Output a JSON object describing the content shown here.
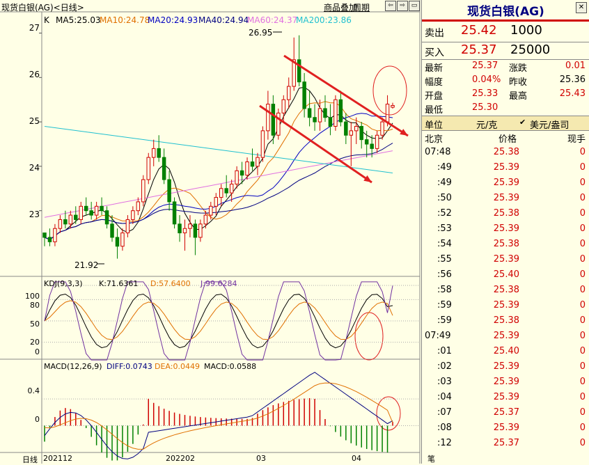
{
  "header": {
    "title": "现货白银(AG)<日线>",
    "menu_overlay": "商品叠加",
    "menu_period": "周期",
    "nav_buttons": [
      "⇦",
      "⇨",
      "▭"
    ]
  },
  "main_chart": {
    "k_label": "K",
    "legend": [
      {
        "text": "MA5:25.03",
        "color": "#000000"
      },
      {
        "text": "MA10:24.78",
        "color": "#e07000"
      },
      {
        "text": "MA20:24.93",
        "color": "#0000c0"
      },
      {
        "text": "MA40:24.94",
        "color": "#000080"
      },
      {
        "text": "MA60:24.37",
        "color": "#e070e0"
      },
      {
        "text": "MA200:23.86",
        "color": "#20c0d0"
      }
    ],
    "y_ticks": [
      "27",
      "26",
      "25",
      "24",
      "23"
    ],
    "high_marker": "26.95",
    "low_marker": "21.92"
  },
  "kdj": {
    "label": "KDJ(9,3,3)",
    "k": "K:71.6361",
    "d": "D:57.6400",
    "j": "J:99.6284",
    "y_ticks": [
      "100",
      "80",
      "50",
      "20",
      "0"
    ]
  },
  "macd": {
    "label": "MACD(12,26,9)",
    "diff": "DIFF:0.0743",
    "dea": "DEA:0.0449",
    "macd": "MACD:0.0588",
    "y_ticks": [
      "0.4",
      "0"
    ]
  },
  "x_axis": {
    "period_label": "日线",
    "ticks": [
      "202112",
      "202202",
      "03",
      "04"
    ]
  },
  "quote_panel": {
    "title": "现货白银(AG)",
    "sell_label": "卖出",
    "sell_price": "25.42",
    "sell_vol": "1000",
    "buy_label": "买入",
    "buy_price": "25.37",
    "buy_vol": "25000",
    "stats": {
      "latest_label": "最新",
      "latest": "25.37",
      "change_label": "涨跌",
      "change": "0.01",
      "pct_label": "幅度",
      "pct": "0.04%",
      "prev_label": "昨收",
      "prev": "25.36",
      "open_label": "开盘",
      "open": "25.33",
      "high_label": "最高",
      "high": "25.43",
      "low_label": "最低",
      "low": "25.30"
    },
    "unit_label": "单位",
    "unit_value": "元/克",
    "unit_option": "美元/盎司",
    "trade_headers": {
      "time": "北京",
      "price": "价格",
      "qty": "现手"
    },
    "trades": [
      {
        "time": "07:48",
        "price": "25.38",
        "qty": "0"
      },
      {
        "time": ":49",
        "price": "25.39",
        "qty": "0"
      },
      {
        "time": ":49",
        "price": "25.39",
        "qty": "0"
      },
      {
        "time": ":50",
        "price": "25.39",
        "qty": "0"
      },
      {
        "time": ":52",
        "price": "25.38",
        "qty": "0"
      },
      {
        "time": ":53",
        "price": "25.39",
        "qty": "0"
      },
      {
        "time": ":54",
        "price": "25.38",
        "qty": "0"
      },
      {
        "time": ":55",
        "price": "25.39",
        "qty": "0"
      },
      {
        "time": ":56",
        "price": "25.40",
        "qty": "0"
      },
      {
        "time": ":58",
        "price": "25.38",
        "qty": "0"
      },
      {
        "time": ":59",
        "price": "25.39",
        "qty": "0"
      },
      {
        "time": ":59",
        "price": "25.38",
        "qty": "0"
      },
      {
        "time": "07:49",
        "price": "25.39",
        "qty": "0"
      },
      {
        "time": ":01",
        "price": "25.40",
        "qty": "0"
      },
      {
        "time": ":02",
        "price": "25.39",
        "qty": "0"
      },
      {
        "time": ":03",
        "price": "25.39",
        "qty": "0"
      },
      {
        "time": ":04",
        "price": "25.39",
        "qty": "0"
      },
      {
        "time": ":07",
        "price": "25.37",
        "qty": "0"
      },
      {
        "time": ":08",
        "price": "25.39",
        "qty": "0"
      },
      {
        "time": ":12",
        "price": "25.37",
        "qty": "0"
      }
    ],
    "bottom_tab": "笔"
  },
  "chart_data": {
    "type": "candlestick",
    "price_range": [
      21.6,
      27.4
    ],
    "candles_ohlc": [
      [
        22.5,
        22.5,
        22.2,
        22.4
      ],
      [
        22.4,
        22.6,
        22.2,
        22.3
      ],
      [
        22.3,
        22.7,
        22.2,
        22.6
      ],
      [
        22.6,
        22.9,
        22.5,
        22.8
      ],
      [
        22.8,
        23.0,
        22.6,
        22.7
      ],
      [
        22.7,
        23.0,
        22.6,
        22.9
      ],
      [
        22.9,
        23.1,
        22.7,
        22.8
      ],
      [
        22.8,
        23.2,
        22.7,
        23.1
      ],
      [
        23.1,
        23.3,
        22.9,
        23.0
      ],
      [
        23.0,
        23.2,
        22.8,
        22.9
      ],
      [
        22.9,
        23.2,
        22.8,
        23.1
      ],
      [
        23.1,
        23.3,
        22.9,
        23.0
      ],
      [
        23.0,
        23.1,
        22.6,
        22.7
      ],
      [
        22.7,
        22.9,
        22.3,
        22.4
      ],
      [
        22.4,
        22.6,
        21.92,
        22.2
      ],
      [
        22.2,
        22.6,
        22.1,
        22.5
      ],
      [
        22.5,
        22.9,
        22.4,
        22.8
      ],
      [
        22.8,
        23.1,
        22.7,
        23.0
      ],
      [
        23.0,
        23.3,
        22.9,
        23.2
      ],
      [
        23.2,
        23.8,
        23.1,
        23.7
      ],
      [
        23.7,
        24.3,
        23.6,
        24.2
      ],
      [
        24.2,
        24.6,
        24.0,
        24.4
      ],
      [
        24.4,
        24.7,
        24.1,
        24.2
      ],
      [
        24.2,
        24.4,
        23.6,
        23.7
      ],
      [
        23.7,
        23.9,
        23.0,
        23.2
      ],
      [
        23.2,
        23.3,
        22.6,
        22.7
      ],
      [
        22.7,
        22.9,
        22.3,
        22.5
      ],
      [
        22.5,
        22.8,
        22.1,
        22.6
      ],
      [
        22.6,
        22.9,
        22.4,
        22.7
      ],
      [
        22.7,
        22.8,
        22.0,
        22.4
      ],
      [
        22.4,
        22.8,
        22.3,
        22.7
      ],
      [
        22.7,
        23.0,
        22.6,
        22.9
      ],
      [
        22.9,
        23.2,
        22.8,
        23.1
      ],
      [
        23.1,
        23.4,
        22.9,
        23.3
      ],
      [
        23.3,
        23.6,
        23.1,
        23.5
      ],
      [
        23.5,
        23.8,
        23.3,
        23.4
      ],
      [
        23.4,
        23.7,
        23.2,
        23.6
      ],
      [
        23.6,
        24.0,
        23.5,
        23.9
      ],
      [
        23.9,
        24.1,
        23.6,
        23.8
      ],
      [
        23.8,
        24.2,
        23.7,
        24.1
      ],
      [
        24.1,
        24.4,
        23.9,
        24.0
      ],
      [
        24.0,
        24.3,
        23.8,
        24.2
      ],
      [
        24.2,
        24.9,
        24.1,
        24.8
      ],
      [
        24.8,
        25.7,
        24.6,
        25.4
      ],
      [
        25.4,
        25.6,
        24.5,
        24.7
      ],
      [
        24.7,
        25.3,
        24.6,
        25.2
      ],
      [
        25.2,
        25.6,
        25.0,
        25.5
      ],
      [
        25.5,
        26.0,
        25.3,
        25.8
      ],
      [
        25.8,
        26.9,
        25.7,
        26.4
      ],
      [
        26.4,
        26.95,
        25.8,
        25.9
      ],
      [
        25.9,
        26.1,
        25.1,
        25.3
      ],
      [
        25.3,
        25.7,
        24.9,
        25.1
      ],
      [
        25.1,
        25.4,
        24.8,
        25.0
      ],
      [
        25.0,
        25.5,
        24.8,
        25.3
      ],
      [
        25.3,
        25.6,
        25.0,
        25.1
      ],
      [
        25.1,
        25.4,
        24.7,
        24.9
      ],
      [
        24.9,
        25.6,
        24.8,
        25.5
      ],
      [
        25.5,
        25.7,
        24.9,
        25.0
      ],
      [
        25.0,
        25.2,
        24.5,
        24.7
      ],
      [
        24.7,
        25.0,
        24.0,
        24.8
      ],
      [
        24.8,
        25.1,
        24.5,
        24.9
      ],
      [
        24.9,
        25.0,
        24.4,
        24.6
      ],
      [
        24.6,
        24.8,
        24.2,
        24.5
      ],
      [
        24.5,
        24.7,
        24.2,
        24.4
      ],
      [
        24.4,
        24.8,
        24.3,
        24.7
      ],
      [
        24.7,
        25.1,
        24.6,
        25.0
      ],
      [
        25.0,
        25.6,
        24.9,
        25.4
      ],
      [
        25.33,
        25.43,
        25.3,
        25.37
      ]
    ],
    "kdj_range": [
      0,
      100
    ],
    "macd_range": [
      -0.35,
      0.85
    ],
    "x_ticks": [
      "202112",
      "202202",
      "03",
      "04"
    ]
  }
}
